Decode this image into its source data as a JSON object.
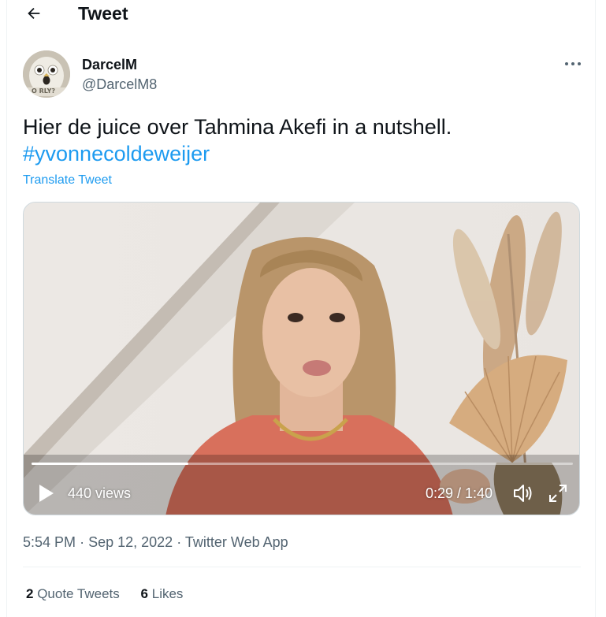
{
  "header": {
    "title": "Tweet"
  },
  "author": {
    "name": "DarcelM",
    "handle": "@DarcelM8",
    "avatar_text": "O RLY?"
  },
  "tweet": {
    "text": "Hier de juice over Tahmina Akefi in a nutshell.",
    "hashtag": "#yvonnecoldeweijer",
    "translate_label": "Translate Tweet"
  },
  "video": {
    "views": "440 views",
    "time": "0:29 / 1:40",
    "progress_fraction": 0.29
  },
  "meta": {
    "time": "5:54 PM",
    "separator": "·",
    "date": "Sep 12, 2022",
    "source": "Twitter Web App"
  },
  "stats": {
    "quote_count": "2",
    "quote_label": "Quote Tweets",
    "likes_count": "6",
    "likes_label": "Likes"
  },
  "colors": {
    "accent": "#1d9bf0",
    "secondary_text": "#536471",
    "primary_text": "#0f1419"
  },
  "icons": [
    "back-arrow-icon",
    "more-icon",
    "play-icon",
    "volume-icon",
    "fullscreen-icon"
  ]
}
